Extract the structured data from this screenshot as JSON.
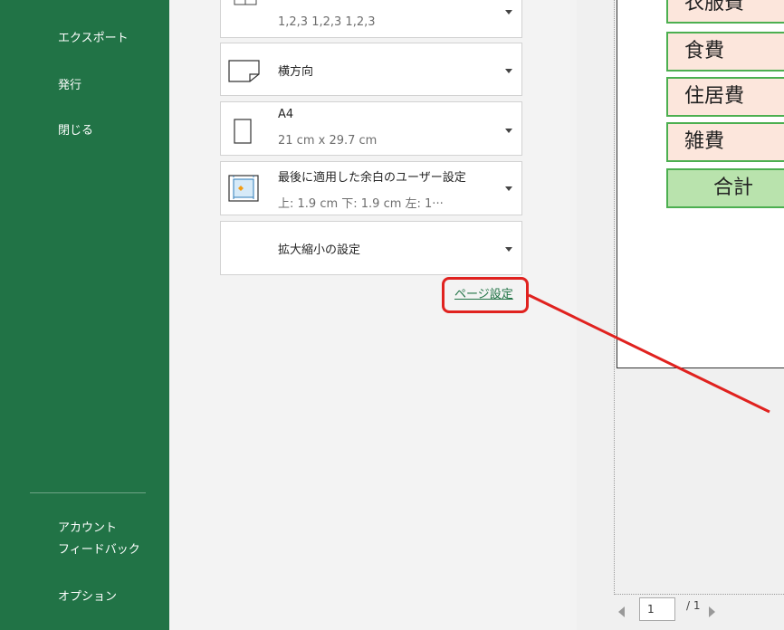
{
  "sidebar": {
    "export": "エクスポート",
    "publish": "発行",
    "close": "閉じる",
    "account": "アカウント",
    "feedback": "フィードバック",
    "options": "オプション"
  },
  "settings": {
    "collate_sub": "1,2,3   1,2,3   1,2,3",
    "orientation": "横方向",
    "paper_title": "A4",
    "paper_sub": "21 cm x 29.7 cm",
    "margins_title": "最後に適用した余白のユーザー設定",
    "margins_sub": "上: 1.9 cm 下: 1.9 cm 左: 1···",
    "scaling": "拡大縮小の設定"
  },
  "page_setup_link": "ページ設定",
  "preview": {
    "cells": [
      "衣服費",
      "食費",
      "住居費",
      "雑費",
      "合計"
    ]
  },
  "pager": {
    "current": "1",
    "total": "/ 1"
  },
  "colors": {
    "sidebar": "#217346",
    "highlight": "#e0221f"
  }
}
